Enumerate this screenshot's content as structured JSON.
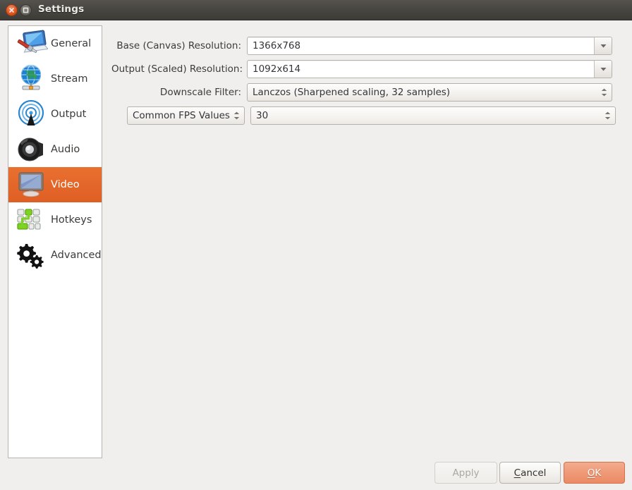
{
  "window": {
    "title": "Settings",
    "controls": [
      {
        "name": "close-button",
        "icon": "close-icon"
      },
      {
        "name": "maximize-button",
        "icon": "maximize-icon"
      }
    ]
  },
  "sidebar": {
    "items": [
      {
        "label": "General",
        "icon": "general-icon",
        "selected": false
      },
      {
        "label": "Stream",
        "icon": "stream-icon",
        "selected": false
      },
      {
        "label": "Output",
        "icon": "output-icon",
        "selected": false
      },
      {
        "label": "Audio",
        "icon": "audio-icon",
        "selected": false
      },
      {
        "label": "Video",
        "icon": "video-icon",
        "selected": true
      },
      {
        "label": "Hotkeys",
        "icon": "hotkeys-icon",
        "selected": false
      },
      {
        "label": "Advanced",
        "icon": "advanced-icon",
        "selected": false
      }
    ]
  },
  "form": {
    "base_resolution": {
      "label": "Base (Canvas) Resolution:",
      "value": "1366x768",
      "control": "editable-combobox",
      "arrow_icon": "chevron-down-icon"
    },
    "output_resolution": {
      "label": "Output (Scaled) Resolution:",
      "value": "1092x614",
      "control": "editable-combobox",
      "arrow_icon": "chevron-down-icon"
    },
    "downscale_filter": {
      "label": "Downscale Filter:",
      "value": "Lanczos (Sharpened scaling, 32 samples)",
      "control": "combobox",
      "arrow_icon": "spinner-arrows-icon"
    },
    "fps": {
      "type_label": "Common FPS Values",
      "type_arrow_icon": "spinner-arrows-icon",
      "value": "30",
      "value_arrow_icon": "spinner-arrows-icon"
    }
  },
  "buttons": {
    "apply": {
      "label": "Apply",
      "enabled": false
    },
    "cancel": {
      "label": "Cancel",
      "mnemonic": "C"
    },
    "ok": {
      "label": "OK",
      "mnemonic": "O",
      "primary": true
    }
  },
  "colors": {
    "accent_orange": "#e4672a",
    "ok_button": "#ef9977",
    "titlebar_dark": "#494741",
    "dialog_background": "#f0efed",
    "panel_white": "#ffffff",
    "text_primary": "#3b3b38"
  }
}
